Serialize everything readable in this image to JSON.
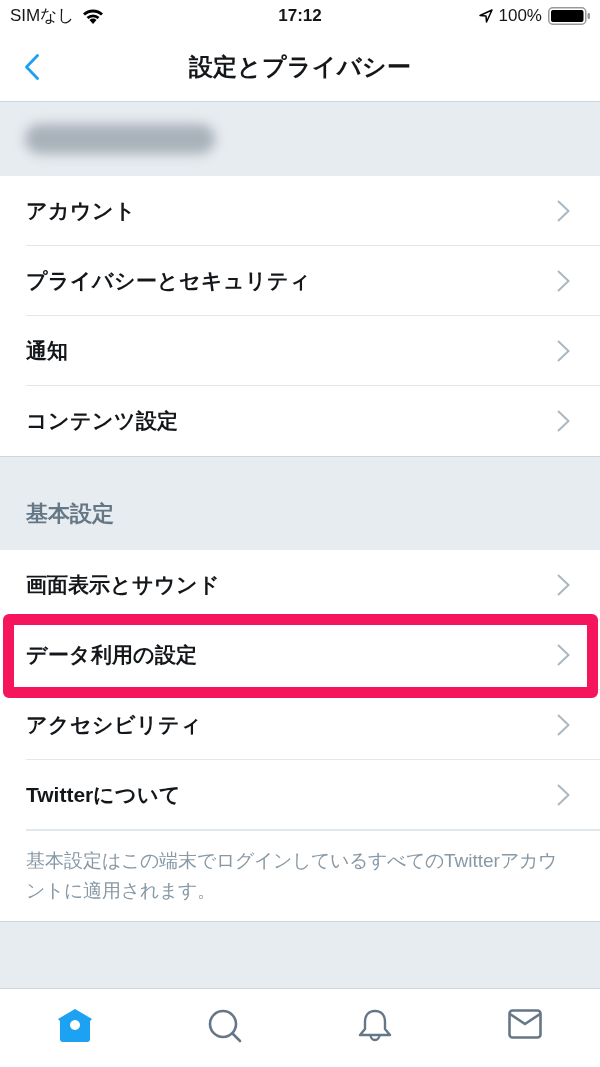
{
  "status_bar": {
    "carrier": "SIMなし",
    "time": "17:12",
    "battery": "100%"
  },
  "nav": {
    "title": "設定とプライバシー"
  },
  "groups": [
    {
      "items": [
        {
          "label": "アカウント",
          "highlighted": false
        },
        {
          "label": "プライバシーとセキュリティ",
          "highlighted": false
        },
        {
          "label": "通知",
          "highlighted": false
        },
        {
          "label": "コンテンツ設定",
          "highlighted": false
        }
      ]
    },
    {
      "header": "基本設定",
      "items": [
        {
          "label": "画面表示とサウンド",
          "highlighted": false
        },
        {
          "label": "データ利用の設定",
          "highlighted": true
        },
        {
          "label": "アクセシビリティ",
          "highlighted": false
        },
        {
          "label": "Twitterについて",
          "highlighted": false
        }
      ],
      "note": "基本設定はこの端末でログインしているすべてのTwitterアカウントに適用されます。"
    }
  ],
  "tab_bar": [
    {
      "kind": "home",
      "selected": true
    },
    {
      "kind": "search",
      "selected": false
    },
    {
      "kind": "notifications",
      "selected": false
    },
    {
      "kind": "messages",
      "selected": false
    }
  ]
}
